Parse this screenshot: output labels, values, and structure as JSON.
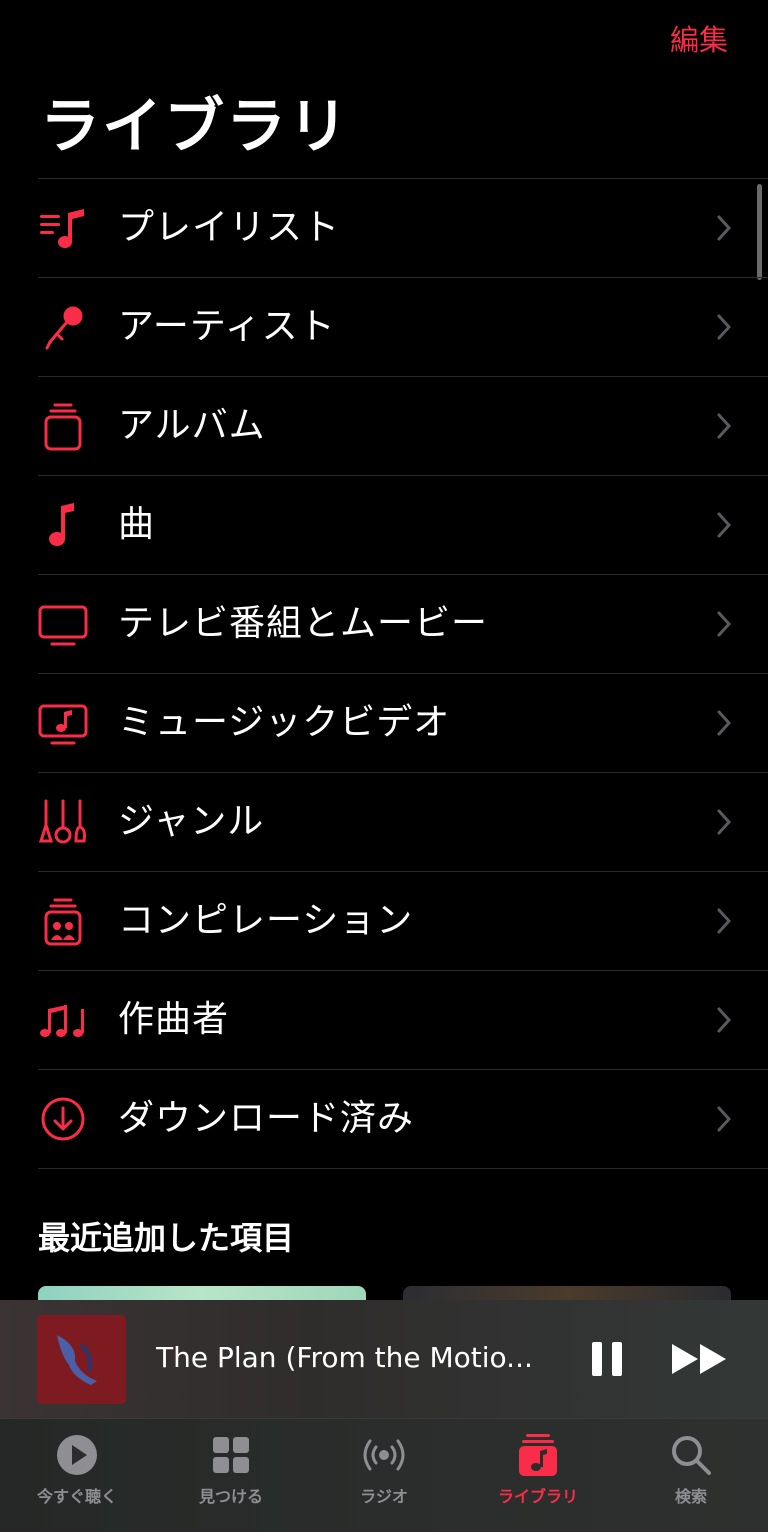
{
  "header": {
    "edit_label": "編集",
    "title": "ライブラリ"
  },
  "menu": [
    {
      "label": "プレイリスト",
      "icon": "playlist-icon"
    },
    {
      "label": "アーティスト",
      "icon": "microphone-icon"
    },
    {
      "label": "アルバム",
      "icon": "album-stack-icon"
    },
    {
      "label": "曲",
      "icon": "music-note-icon"
    },
    {
      "label": "テレビ番組とムービー",
      "icon": "tv-icon"
    },
    {
      "label": "ミュージックビデオ",
      "icon": "music-video-icon"
    },
    {
      "label": "ジャンル",
      "icon": "guitars-icon"
    },
    {
      "label": "コンピレーション",
      "icon": "compilation-icon"
    },
    {
      "label": "作曲者",
      "icon": "composer-notes-icon"
    },
    {
      "label": "ダウンロード済み",
      "icon": "download-circle-icon"
    }
  ],
  "recent": {
    "title": "最近追加した項目"
  },
  "now_playing": {
    "title": "The Plan (From the Motio..."
  },
  "tabs": [
    {
      "label": "今すぐ聴く",
      "icon": "play-circle-icon"
    },
    {
      "label": "見つける",
      "icon": "grid-icon"
    },
    {
      "label": "ラジオ",
      "icon": "radio-waves-icon"
    },
    {
      "label": "ライブラリ",
      "icon": "library-music-icon"
    },
    {
      "label": "検索",
      "icon": "magnifier-icon"
    }
  ],
  "colors": {
    "accent": "#fa2d48",
    "background": "#000000",
    "inactive": "#8e8e93"
  }
}
